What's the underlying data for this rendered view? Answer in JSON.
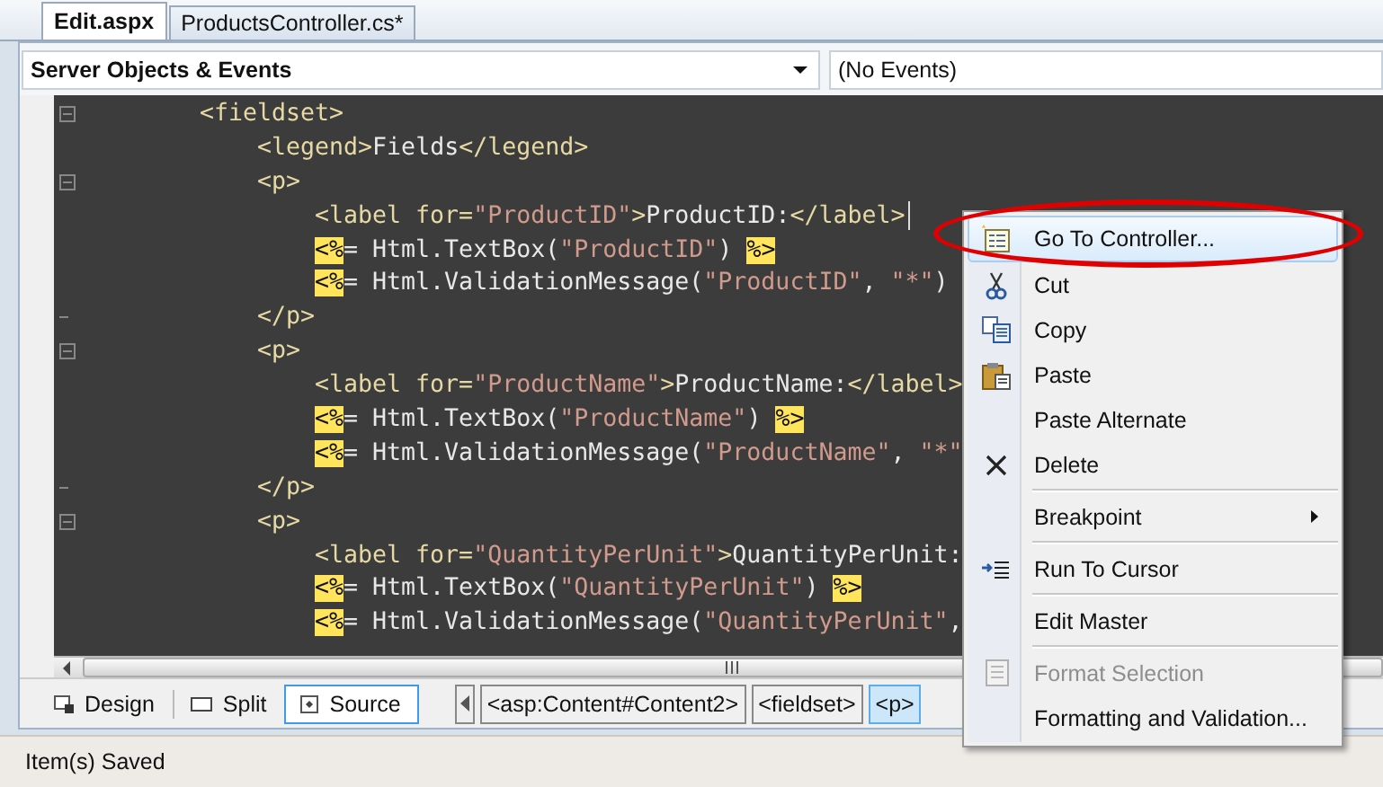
{
  "tabs": [
    {
      "label": "Edit.aspx",
      "selected": true
    },
    {
      "label": "ProductsController.cs*",
      "selected": false
    }
  ],
  "navigation": {
    "objects": "Server Objects & Events",
    "events": "(No Events)"
  },
  "code_lines": [
    {
      "collapsible": true,
      "tokens": [
        {
          "kind": "tag",
          "text": "<fieldset>"
        }
      ],
      "children": [
        {
          "collapsible": false,
          "tokens": [
            {
              "kind": "tag",
              "text": "<legend>"
            },
            {
              "kind": "text",
              "text": "Fields"
            },
            {
              "kind": "tag",
              "text": "</legend>"
            }
          ]
        },
        {
          "collapsible": true,
          "tokens": [
            {
              "kind": "tag",
              "text": "<p>"
            }
          ],
          "children": [
            {
              "collapsible": false,
              "caret": true,
              "tokens": [
                {
                  "kind": "tag",
                  "text": "<label for="
                },
                {
                  "kind": "string",
                  "text": "\"ProductID\""
                },
                {
                  "kind": "tag",
                  "text": ">"
                },
                {
                  "kind": "text",
                  "text": "ProductID:"
                },
                {
                  "kind": "tag",
                  "text": "</label>"
                }
              ]
            },
            {
              "collapsible": false,
              "tokens": [
                {
                  "kind": "delim",
                  "text": "<%"
                },
                {
                  "kind": "text",
                  "text": "= Html.TextBox("
                },
                {
                  "kind": "string",
                  "text": "\"ProductID\""
                },
                {
                  "kind": "text",
                  "text": ") "
                },
                {
                  "kind": "delim",
                  "text": "%>"
                }
              ]
            },
            {
              "collapsible": false,
              "tokens": [
                {
                  "kind": "delim",
                  "text": "<%"
                },
                {
                  "kind": "text",
                  "text": "= Html.ValidationMessage("
                },
                {
                  "kind": "string",
                  "text": "\"ProductID\""
                },
                {
                  "kind": "text",
                  "text": ", "
                },
                {
                  "kind": "string",
                  "text": "\"*\""
                },
                {
                  "kind": "text",
                  "text": ")"
                }
              ]
            }
          ],
          "closing": {
            "tokens": [
              {
                "kind": "tag",
                "text": "</p>"
              }
            ]
          }
        },
        {
          "collapsible": true,
          "tokens": [
            {
              "kind": "tag",
              "text": "<p>"
            }
          ],
          "children": [
            {
              "collapsible": false,
              "tokens": [
                {
                  "kind": "tag",
                  "text": "<label for="
                },
                {
                  "kind": "string",
                  "text": "\"ProductName\""
                },
                {
                  "kind": "tag",
                  "text": ">"
                },
                {
                  "kind": "text",
                  "text": "ProductName:"
                },
                {
                  "kind": "tag",
                  "text": "</label>"
                }
              ]
            },
            {
              "collapsible": false,
              "tokens": [
                {
                  "kind": "delim",
                  "text": "<%"
                },
                {
                  "kind": "text",
                  "text": "= Html.TextBox("
                },
                {
                  "kind": "string",
                  "text": "\"ProductName\""
                },
                {
                  "kind": "text",
                  "text": ") "
                },
                {
                  "kind": "delim",
                  "text": "%>"
                }
              ]
            },
            {
              "collapsible": false,
              "tokens": [
                {
                  "kind": "delim",
                  "text": "<%"
                },
                {
                  "kind": "text",
                  "text": "= Html.ValidationMessage("
                },
                {
                  "kind": "string",
                  "text": "\"ProductName\""
                },
                {
                  "kind": "text",
                  "text": ", "
                },
                {
                  "kind": "string",
                  "text": "\"*\""
                }
              ]
            }
          ],
          "closing": {
            "tokens": [
              {
                "kind": "tag",
                "text": "</p>"
              }
            ]
          }
        },
        {
          "collapsible": true,
          "tokens": [
            {
              "kind": "tag",
              "text": "<p>"
            }
          ],
          "children": [
            {
              "collapsible": false,
              "tokens": [
                {
                  "kind": "tag",
                  "text": "<label for="
                },
                {
                  "kind": "string",
                  "text": "\"QuantityPerUnit\""
                },
                {
                  "kind": "tag",
                  "text": ">"
                },
                {
                  "kind": "text",
                  "text": "QuantityPerUnit:"
                }
              ]
            },
            {
              "collapsible": false,
              "tokens": [
                {
                  "kind": "delim",
                  "text": "<%"
                },
                {
                  "kind": "text",
                  "text": "= Html.TextBox("
                },
                {
                  "kind": "string",
                  "text": "\"QuantityPerUnit\""
                },
                {
                  "kind": "text",
                  "text": ") "
                },
                {
                  "kind": "delim",
                  "text": "%>"
                }
              ]
            },
            {
              "collapsible": false,
              "tokens": [
                {
                  "kind": "delim",
                  "text": "<%"
                },
                {
                  "kind": "text",
                  "text": "= Html.ValidationMessage("
                },
                {
                  "kind": "string",
                  "text": "\"QuantityPerUnit\""
                },
                {
                  "kind": "text",
                  "text": ","
                }
              ]
            }
          ]
        }
      ]
    }
  ],
  "view_buttons": [
    {
      "label": "Design",
      "selected": false
    },
    {
      "label": "Split",
      "selected": false
    },
    {
      "label": "Source",
      "selected": true
    }
  ],
  "breadcrumb": [
    {
      "label": "<asp:Content#Content2>",
      "selected": false
    },
    {
      "label": "<fieldset>",
      "selected": false
    },
    {
      "label": "<p>",
      "selected": true
    }
  ],
  "context_menu": [
    {
      "kind": "item",
      "label": "Go To Controller...",
      "highlighted": true,
      "circled": true,
      "disabled": false
    },
    {
      "kind": "item",
      "label": "Cut",
      "highlighted": false,
      "disabled": false
    },
    {
      "kind": "item",
      "label": "Copy",
      "highlighted": false,
      "disabled": false
    },
    {
      "kind": "item",
      "label": "Paste",
      "highlighted": false,
      "disabled": false
    },
    {
      "kind": "item",
      "label": "Paste Alternate",
      "highlighted": false,
      "disabled": false
    },
    {
      "kind": "item",
      "label": "Delete",
      "highlighted": false,
      "disabled": false
    },
    {
      "kind": "separator"
    },
    {
      "kind": "item",
      "label": "Breakpoint",
      "submenu": true,
      "highlighted": false,
      "disabled": false
    },
    {
      "kind": "separator"
    },
    {
      "kind": "item",
      "label": "Run To Cursor",
      "highlighted": false,
      "disabled": false
    },
    {
      "kind": "separator"
    },
    {
      "kind": "item",
      "label": "Edit Master",
      "highlighted": false,
      "disabled": false
    },
    {
      "kind": "separator"
    },
    {
      "kind": "item",
      "label": "Format Selection",
      "highlighted": false,
      "disabled": true
    },
    {
      "kind": "item",
      "label": "Formatting and Validation...",
      "highlighted": false,
      "disabled": false
    }
  ],
  "status_bar": {
    "text": "Item(s) Saved"
  }
}
